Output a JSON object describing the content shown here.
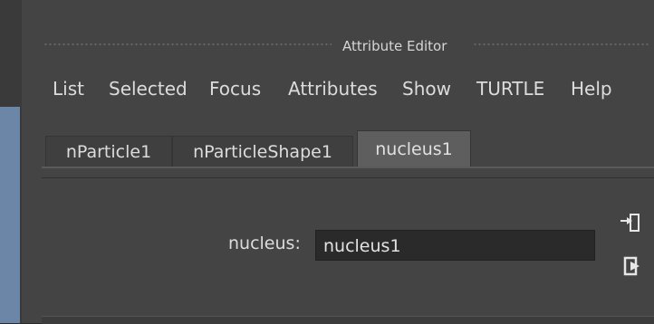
{
  "window": {
    "title": "Attribute Editor"
  },
  "menubar": {
    "items": [
      "List",
      "Selected",
      "Focus",
      "Attributes",
      "Show",
      "TURTLE",
      "Help"
    ]
  },
  "tabs": {
    "items": [
      "nParticle1",
      "nParticleShape1",
      "nucleus1"
    ],
    "active": "nucleus1"
  },
  "node": {
    "label": "nucleus:",
    "value": "nucleus1"
  },
  "icons": {
    "select_input": "input-connection-icon",
    "select_output": "output-connection-icon"
  }
}
